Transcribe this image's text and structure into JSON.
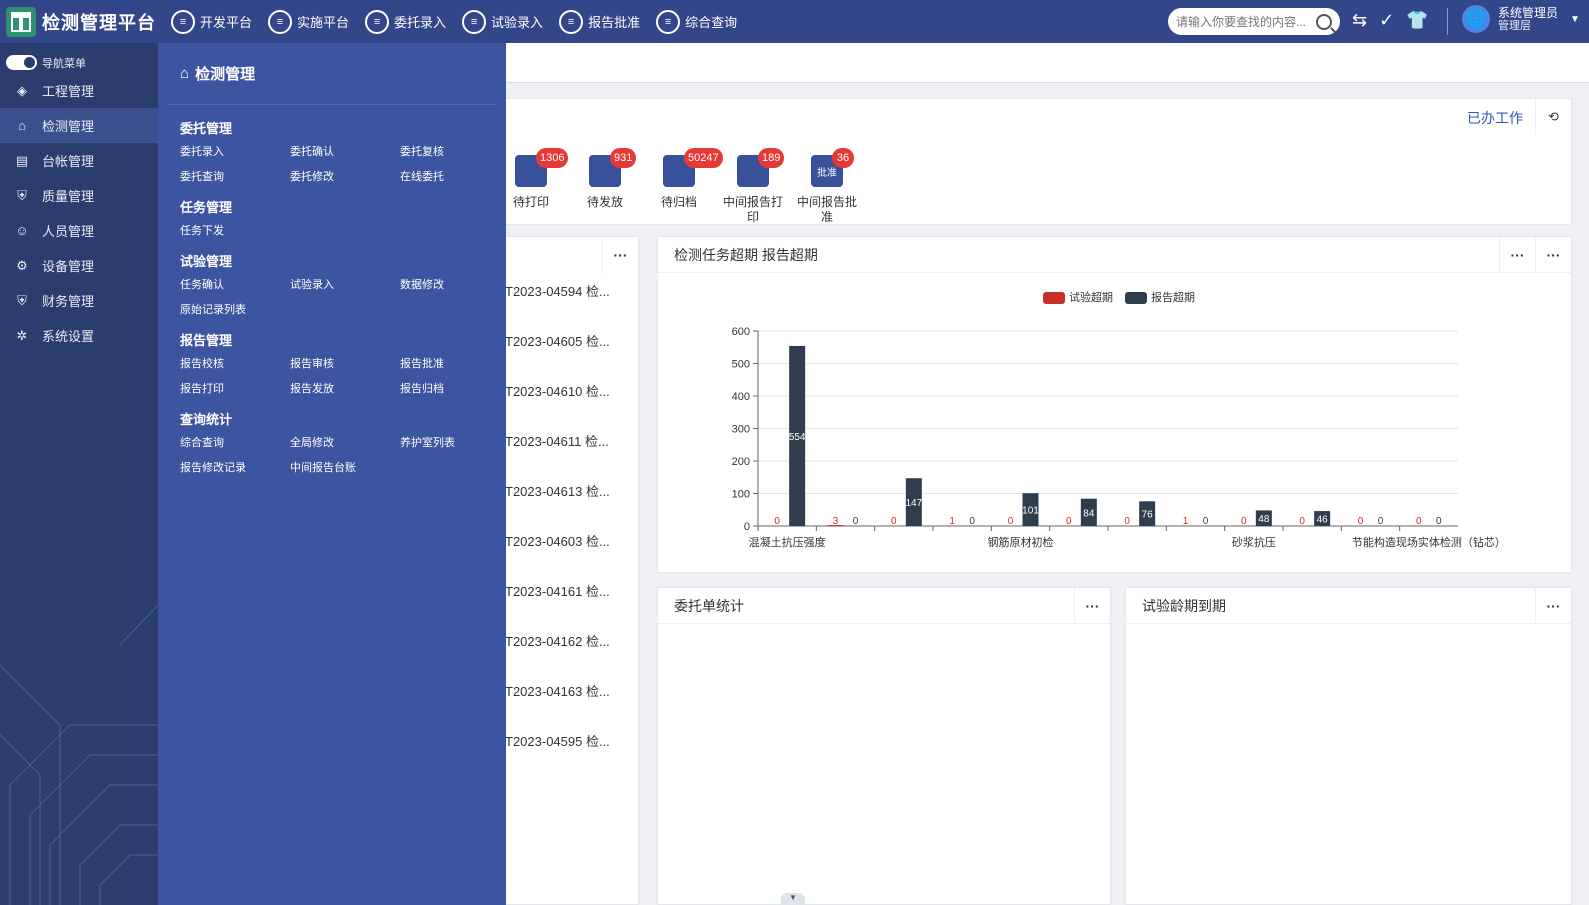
{
  "app": {
    "title": "检测管理平台"
  },
  "topnav": [
    {
      "label": "开发平台"
    },
    {
      "label": "实施平台"
    },
    {
      "label": "委托录入"
    },
    {
      "label": "试验录入"
    },
    {
      "label": "报告批准"
    },
    {
      "label": "综合查询"
    }
  ],
  "search": {
    "placeholder": "请输入你要查找的内容..."
  },
  "user": {
    "name": "系统管理员",
    "role": "管理层"
  },
  "sidebar": {
    "toggle_label": "导航菜单",
    "items": [
      {
        "label": "工程管理",
        "icon": "layers-icon"
      },
      {
        "label": "检测管理",
        "icon": "building-icon"
      },
      {
        "label": "台帐管理",
        "icon": "ledger-icon"
      },
      {
        "label": "质量管理",
        "icon": "shield-icon"
      },
      {
        "label": "人员管理",
        "icon": "person-icon"
      },
      {
        "label": "设备管理",
        "icon": "device-icon"
      },
      {
        "label": "财务管理",
        "icon": "finance-icon"
      },
      {
        "label": "系统设置",
        "icon": "gear-icon"
      }
    ]
  },
  "flyout": {
    "title": "检测管理",
    "groups": [
      {
        "title": "委托管理",
        "links": [
          "委托录入",
          "委托确认",
          "委托复核",
          "委托查询",
          "委托修改",
          "在线委托"
        ]
      },
      {
        "title": "任务管理",
        "links": [
          "任务下发"
        ]
      },
      {
        "title": "试验管理",
        "links": [
          "任务确认",
          "试验录入",
          "数据修改",
          "原始记录列表"
        ]
      },
      {
        "title": "报告管理",
        "links": [
          "报告校核",
          "报告审核",
          "报告批准",
          "报告打印",
          "报告发放",
          "报告归档"
        ]
      },
      {
        "title": "查询统计",
        "links": [
          "综合查询",
          "全局修改",
          "养护室列表",
          "报告修改记录",
          "中间报告台账"
        ]
      }
    ]
  },
  "work_panel": {
    "done_link": "已办工作",
    "tasks": [
      {
        "label": "待打印",
        "badge": "1306"
      },
      {
        "label": "待发放",
        "badge": "931"
      },
      {
        "label": "待归档",
        "badge": "50247"
      },
      {
        "label": "中间报告打印",
        "badge": "189"
      },
      {
        "label": "中间报告批准",
        "badge": "36",
        "icon_text": "批准"
      }
    ]
  },
  "report_list": {
    "items": [
      "T2023-04594 检...",
      "T2023-04605 检...",
      "T2023-04610 检...",
      "T2023-04611 检...",
      "T2023-04613 检...",
      "T2023-04603 检...",
      "T2023-04161 检...",
      "T2023-04162 检...",
      "T2023-04163 检...",
      "T2023-04595 检..."
    ]
  },
  "overdue_chart": {
    "title": "检测任务超期 报告超期"
  },
  "commission_card": {
    "title": "委托单统计"
  },
  "age_card": {
    "title": "试验龄期到期"
  },
  "more_label": "···",
  "colors": {
    "topbar": "#324689",
    "sidebar": "#2b3c6f",
    "flyout": "#3d55a0",
    "series_test": "#c9302c",
    "series_report": "#2f3e4e",
    "badge": "#e53935"
  },
  "chart_data": {
    "type": "bar",
    "categories": [
      "混凝土抗压强度",
      "",
      "",
      "",
      "钢筋原材初检",
      "",
      "",
      "",
      "砂浆抗压",
      "",
      "",
      "节能构造现场实体检测（钻芯）"
    ],
    "series": [
      {
        "name": "试验超期",
        "values": [
          0,
          3,
          0,
          1,
          0,
          0,
          0,
          1,
          0,
          0,
          0,
          0
        ]
      },
      {
        "name": "报告超期",
        "values": [
          554,
          0,
          147,
          0,
          101,
          84,
          76,
          0,
          48,
          46,
          0,
          0
        ]
      }
    ],
    "ylim": [
      0,
      600
    ],
    "yticks": [
      0,
      100,
      200,
      300,
      400,
      500,
      600
    ],
    "grid": true,
    "legend": "top-center"
  }
}
